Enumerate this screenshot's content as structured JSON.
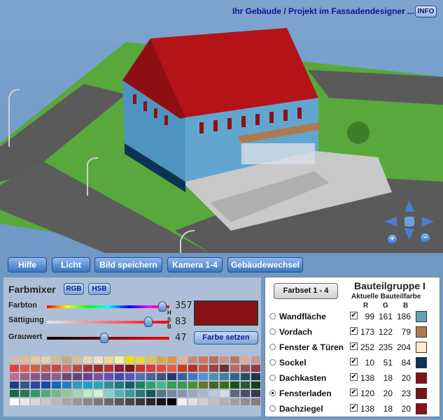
{
  "header": {
    "title": "Ihr Gebäude / Projekt im Fassadendesigner ...",
    "info_label": "INFO"
  },
  "toolbar": {
    "buttons": [
      "Hilfe",
      "Licht",
      "Bild speichern",
      "Kamera 1-4",
      "Gebäudewechsel"
    ]
  },
  "mixer": {
    "title": "Farbmixer",
    "rgb_label": "RGB",
    "hsb_label": "HSB",
    "sliders": [
      {
        "label": "Farbton",
        "value": "357",
        "fraction": 0.94
      },
      {
        "label": "Sättigung",
        "value": "83",
        "fraction": 0.83
      },
      {
        "label": "Grauwert",
        "value": "47",
        "fraction": 0.47
      }
    ],
    "hsb_letters": [
      "H",
      "S",
      "B"
    ],
    "preview_color": "#8a1214",
    "set_color_label": "Farbe setzen"
  },
  "palette": {
    "rows": [
      [
        "#d8b8a8",
        "#e8b890",
        "#e8c898",
        "#e8d0a0",
        "#d8b890",
        "#c8a878",
        "#d8c098",
        "#e8d8b0",
        "#f0e0c0",
        "#f0d890",
        "#f8f0a0",
        "#f0e000",
        "#e8d838",
        "#e0c060",
        "#d8a848",
        "#d89848",
        "#e8b0a0",
        "#d08870",
        "#c87860",
        "#c07050",
        "#d09080",
        "#b87860",
        "#e0a8a0",
        "#c89898"
      ],
      [
        "#e04040",
        "#e05848",
        "#d86040",
        "#c85848",
        "#c84848",
        "#d86868",
        "#b84848",
        "#a03838",
        "#a02828",
        "#c03030",
        "#902030",
        "#801818",
        "#d03030",
        "#e03838",
        "#e84830",
        "#e06040",
        "#c84020",
        "#b83028",
        "#c85040",
        "#a04040",
        "#703030",
        "#c06860",
        "#a05050",
        "#903848"
      ],
      [
        "#b87090",
        "#a06078",
        "#985088",
        "#885080",
        "#906088",
        "#704870",
        "#604870",
        "#704090",
        "#8050a0",
        "#6050b0",
        "#4848a8",
        "#5858c0",
        "#5070b0",
        "#486098",
        "#405080",
        "#283870",
        "#3860a0",
        "#4878c0",
        "#5890d0",
        "#4890b0",
        "#4080a0",
        "#306880",
        "#285060",
        "#203848"
      ],
      [
        "#204078",
        "#305888",
        "#28489c",
        "#1848a0",
        "#1868b0",
        "#2080c0",
        "#3098b8",
        "#20a0c0",
        "#28a8a8",
        "#309090",
        "#207878",
        "#186060",
        "#208060",
        "#30a070",
        "#48b880",
        "#30a050",
        "#409840",
        "#509030",
        "#607828",
        "#486818",
        "#387010",
        "#205010",
        "#305828",
        "#184020"
      ],
      [
        "#186840",
        "#287848",
        "#389858",
        "#58a868",
        "#78b878",
        "#98c888",
        "#a8d8a8",
        "#c8e8b8",
        "#d8f0c8",
        "#88d0c8",
        "#58b0b0",
        "#389898",
        "#287878",
        "#185858",
        "#58787f",
        "#788898",
        "#8898a8",
        "#98a8b8",
        "#a8b8c8",
        "#b8c8d8",
        "#d0d8e0",
        "#606878",
        "#485060",
        "#383848"
      ],
      [
        "#f8f8f8",
        "#e8e8e8",
        "#d8d8d8",
        "#c8c8c8",
        "#b8b8b8",
        "#a8a8a8",
        "#989898",
        "#888888",
        "#787878",
        "#686868",
        "#585858",
        "#484848",
        "#383838",
        "#282828",
        "#181818",
        "#000000",
        "#f0f0f0",
        "#e0e0e0",
        "#d0d0d0",
        "#c0c0c0",
        "#b0b0b0",
        "#a0a0a0",
        "#909090",
        "#808080"
      ]
    ]
  },
  "parts": {
    "farbset_label": "Farbset 1 - 4",
    "group_title": "Bauteilgruppe I",
    "current_color_label": "Aktuelle Bauteilfarbe",
    "col_r": "R",
    "col_g": "G",
    "col_b": "B",
    "rows": [
      {
        "name": "Wandfläche",
        "checked": true,
        "selected": false,
        "r": "99",
        "g": "161",
        "b": "186",
        "color": "#63a1ba"
      },
      {
        "name": "Vordach",
        "checked": true,
        "selected": false,
        "r": "173",
        "g": "122",
        "b": "79",
        "color": "#ad7a4f"
      },
      {
        "name": "Fenster & Türen",
        "checked": true,
        "selected": false,
        "r": "252",
        "g": "235",
        "b": "204",
        "color": "#fcebcc"
      },
      {
        "name": "Sockel",
        "checked": true,
        "selected": false,
        "r": "10",
        "g": "51",
        "b": "84",
        "color": "#0a3354"
      },
      {
        "name": "Dachkasten",
        "checked": true,
        "selected": false,
        "r": "138",
        "g": "18",
        "b": "20",
        "color": "#8a1214"
      },
      {
        "name": "Fensterladen",
        "checked": true,
        "selected": true,
        "r": "120",
        "g": "20",
        "b": "23",
        "color": "#781417"
      },
      {
        "name": "Dachziegel",
        "checked": true,
        "selected": false,
        "r": "138",
        "g": "18",
        "b": "20",
        "color": "#8a1214"
      }
    ]
  },
  "icons": {
    "nav_arrows": "navigation-arrows-icon",
    "zoom_in": "zoom-in-icon",
    "zoom_out": "zoom-out-icon"
  }
}
